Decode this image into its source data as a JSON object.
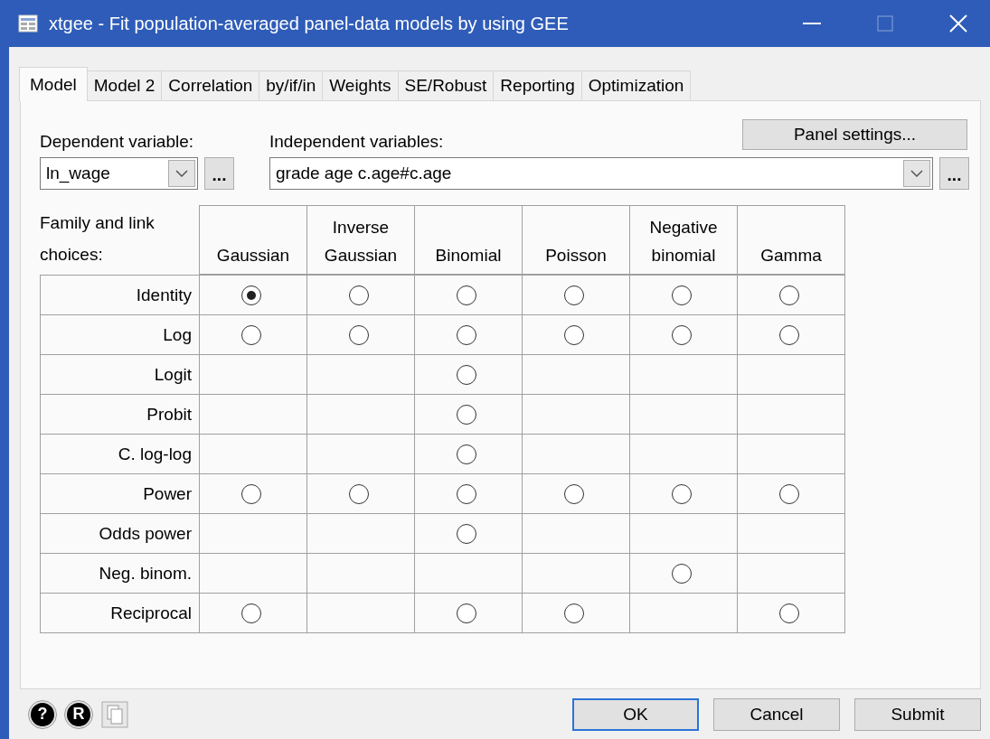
{
  "window": {
    "title": "xtgee - Fit population-averaged panel-data models by using GEE"
  },
  "tabs": [
    {
      "label": "Model",
      "selected": true
    },
    {
      "label": "Model 2",
      "selected": false
    },
    {
      "label": "Correlation",
      "selected": false
    },
    {
      "label": "by/if/in",
      "selected": false
    },
    {
      "label": "Weights",
      "selected": false
    },
    {
      "label": "SE/Robust",
      "selected": false
    },
    {
      "label": "Reporting",
      "selected": false
    },
    {
      "label": "Optimization",
      "selected": false
    }
  ],
  "panel_settings_button": "Panel settings...",
  "dependent": {
    "label": "Dependent variable:",
    "value": "ln_wage",
    "browse": "..."
  },
  "independent": {
    "label": "Independent variables:",
    "value": "grade age c.age#c.age",
    "browse": "..."
  },
  "grid": {
    "corner": "Family and link choices:",
    "columns": [
      "Gaussian",
      "Inverse Gaussian",
      "Binomial",
      "Poisson",
      "Negative binomial",
      "Gamma"
    ],
    "rows": [
      {
        "label": "Identity",
        "cells": [
          {
            "kind": "radio",
            "selected": true
          },
          {
            "kind": "radio",
            "selected": false
          },
          {
            "kind": "radio",
            "selected": false
          },
          {
            "kind": "radio",
            "selected": false
          },
          {
            "kind": "radio",
            "selected": false
          },
          {
            "kind": "radio",
            "selected": false
          }
        ]
      },
      {
        "label": "Log",
        "cells": [
          {
            "kind": "radio",
            "selected": false
          },
          {
            "kind": "radio",
            "selected": false
          },
          {
            "kind": "radio",
            "selected": false
          },
          {
            "kind": "radio",
            "selected": false
          },
          {
            "kind": "radio",
            "selected": false
          },
          {
            "kind": "radio",
            "selected": false
          }
        ]
      },
      {
        "label": "Logit",
        "cells": [
          {
            "kind": "empty"
          },
          {
            "kind": "empty"
          },
          {
            "kind": "radio",
            "selected": false
          },
          {
            "kind": "empty"
          },
          {
            "kind": "empty"
          },
          {
            "kind": "empty"
          }
        ]
      },
      {
        "label": "Probit",
        "cells": [
          {
            "kind": "empty"
          },
          {
            "kind": "empty"
          },
          {
            "kind": "radio",
            "selected": false
          },
          {
            "kind": "empty"
          },
          {
            "kind": "empty"
          },
          {
            "kind": "empty"
          }
        ]
      },
      {
        "label": "C. log-log",
        "cells": [
          {
            "kind": "empty"
          },
          {
            "kind": "empty"
          },
          {
            "kind": "radio",
            "selected": false
          },
          {
            "kind": "empty"
          },
          {
            "kind": "empty"
          },
          {
            "kind": "empty"
          }
        ]
      },
      {
        "label": "Power",
        "cells": [
          {
            "kind": "radio",
            "selected": false
          },
          {
            "kind": "radio",
            "selected": false
          },
          {
            "kind": "radio",
            "selected": false
          },
          {
            "kind": "radio",
            "selected": false
          },
          {
            "kind": "radio",
            "selected": false
          },
          {
            "kind": "radio",
            "selected": false
          }
        ]
      },
      {
        "label": "Odds power",
        "cells": [
          {
            "kind": "empty"
          },
          {
            "kind": "empty"
          },
          {
            "kind": "radio",
            "selected": false
          },
          {
            "kind": "empty"
          },
          {
            "kind": "empty"
          },
          {
            "kind": "empty"
          }
        ]
      },
      {
        "label": "Neg. binom.",
        "cells": [
          {
            "kind": "empty"
          },
          {
            "kind": "empty"
          },
          {
            "kind": "empty"
          },
          {
            "kind": "empty"
          },
          {
            "kind": "radio",
            "selected": false
          },
          {
            "kind": "empty"
          }
        ]
      },
      {
        "label": "Reciprocal",
        "cells": [
          {
            "kind": "radio",
            "selected": false
          },
          {
            "kind": "empty"
          },
          {
            "kind": "radio",
            "selected": false
          },
          {
            "kind": "radio",
            "selected": false
          },
          {
            "kind": "empty"
          },
          {
            "kind": "radio",
            "selected": false
          }
        ]
      }
    ]
  },
  "footer": {
    "help": "?",
    "reset": "R",
    "buttons": [
      "OK",
      "Cancel",
      "Submit"
    ]
  }
}
